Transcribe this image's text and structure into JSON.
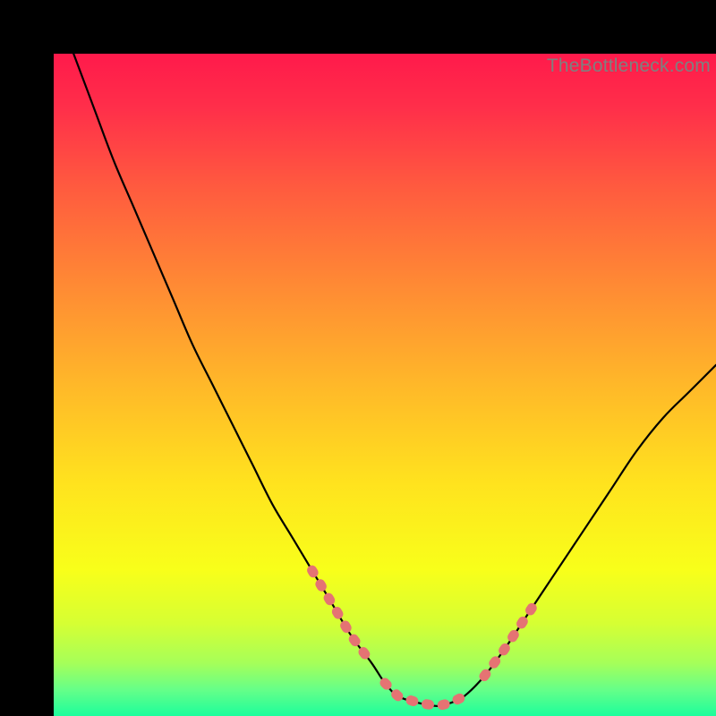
{
  "watermark": "TheBottleneck.com",
  "colors": {
    "background": "#000000",
    "curve_stroke": "#000000",
    "segment_marker": "#e57373",
    "gradient_stops": [
      {
        "offset": 0.0,
        "color": "#ff1a4b"
      },
      {
        "offset": 0.08,
        "color": "#ff2e4a"
      },
      {
        "offset": 0.2,
        "color": "#ff5a3f"
      },
      {
        "offset": 0.35,
        "color": "#ff8a34"
      },
      {
        "offset": 0.5,
        "color": "#ffb829"
      },
      {
        "offset": 0.65,
        "color": "#ffe31e"
      },
      {
        "offset": 0.78,
        "color": "#f8ff1a"
      },
      {
        "offset": 0.86,
        "color": "#d6ff33"
      },
      {
        "offset": 0.92,
        "color": "#a6ff59"
      },
      {
        "offset": 0.96,
        "color": "#66ff88"
      },
      {
        "offset": 1.0,
        "color": "#1dfd9c"
      }
    ]
  },
  "chart_data": {
    "type": "line",
    "title": "",
    "xlabel": "",
    "ylabel": "",
    "xlim": [
      0,
      100
    ],
    "ylim": [
      0,
      100
    ],
    "x": [
      3,
      6,
      9,
      12,
      15,
      18,
      21,
      24,
      27,
      30,
      33,
      36,
      39,
      42,
      45,
      48,
      50,
      52,
      55,
      58,
      60,
      62,
      65,
      68,
      72,
      76,
      80,
      84,
      88,
      92,
      96,
      100
    ],
    "values": [
      100,
      92,
      84,
      77,
      70,
      63,
      56,
      50,
      44,
      38,
      32,
      27,
      22,
      17,
      12,
      8,
      5,
      3,
      2,
      1.5,
      2,
      3,
      6,
      10,
      16,
      22,
      28,
      34,
      40,
      45,
      49,
      53
    ],
    "highlighted_segments": [
      {
        "x_start": 39,
        "x_end": 48
      },
      {
        "x_start": 50,
        "x_end": 62
      },
      {
        "x_start": 65,
        "x_end": 73
      }
    ]
  }
}
